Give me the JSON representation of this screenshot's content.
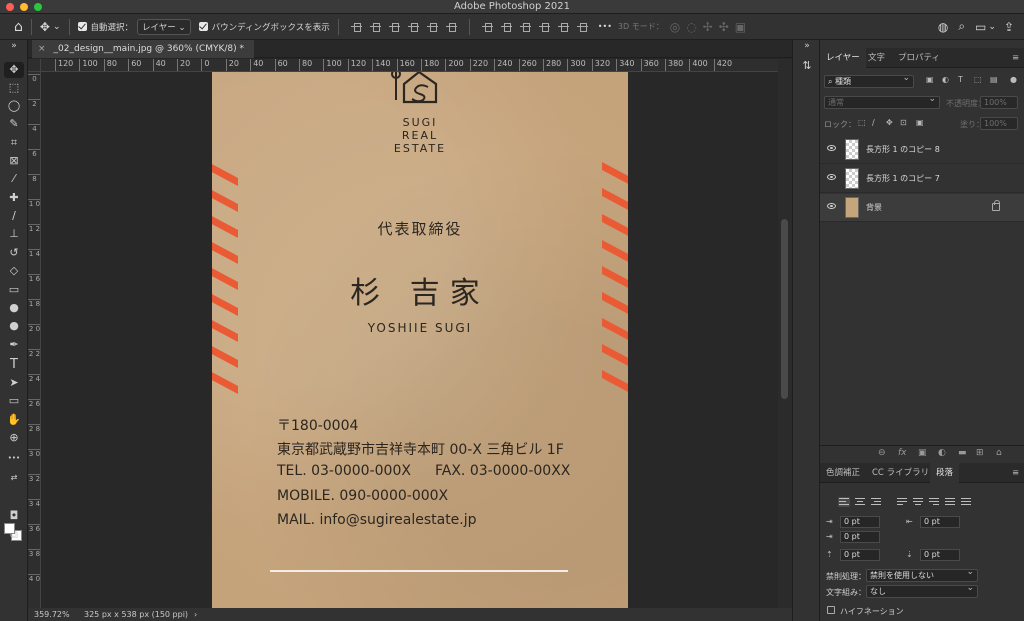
{
  "window": {
    "title": "Adobe Photoshop 2021"
  },
  "options_bar": {
    "auto_select_label": "自動選択：",
    "auto_select_target": "レイヤー",
    "bounding_box_label": "バウンディングボックスを表示",
    "mode_3d_label": "3D モード："
  },
  "document": {
    "tab_title": "_02_design__main.jpg @ 360% (CMYK/8) *",
    "close_glyph": "×",
    "zoom": "359.72%",
    "size_info": "325 px x 538 px (150 ppi)",
    "status_arrow": "›"
  },
  "ruler": {
    "h_ticks": [
      "120",
      "100",
      "80",
      "60",
      "40",
      "20",
      "0",
      "20",
      "40",
      "60",
      "80",
      "100",
      "120",
      "140",
      "160",
      "180",
      "200",
      "220",
      "240",
      "260",
      "280",
      "300",
      "320",
      "340",
      "360",
      "380",
      "400",
      "420"
    ],
    "v_ticks": [
      "0",
      "2",
      "4",
      "6",
      "8",
      "1 0",
      "1 2",
      "1 4",
      "1 6",
      "1 8",
      "2 0",
      "2 2",
      "2 4",
      "2 6",
      "2 8",
      "3 0",
      "3 2",
      "3 4",
      "3 6",
      "3 8",
      "4 0"
    ]
  },
  "card": {
    "logo_lines": [
      "SUGI",
      "REAL",
      "ESTATE"
    ],
    "title": "代表取締役",
    "name_jp": "杉 吉家",
    "name_en": "YOSHIIE SUGI",
    "postal": "〒180-0004",
    "address": "東京都武蔵野市吉祥寺本町 00-X 三角ビル 1F",
    "tel": "TEL. 03-0000-000X",
    "fax": "FAX. 03-0000-00XX",
    "mobile": "MOBILE. 090-0000-000X",
    "mail": "MAIL. info@sugirealestate.jp",
    "colors": {
      "kraft": "#c8a77f",
      "stripe": "#ea5b35",
      "ink": "#2b2620"
    }
  },
  "layers_panel": {
    "tabs": [
      "レイヤー",
      "文字",
      "プロパティ"
    ],
    "filter_label": "種類",
    "blend_mode": "通常",
    "opacity_label": "不透明度：",
    "opacity_value": "100%",
    "lock_label": "ロック：",
    "fill_label": "塗り：",
    "fill_value": "100%",
    "layers": [
      {
        "name": "長方形 1 のコピー 8",
        "visible": true,
        "locked": false
      },
      {
        "name": "長方形 1 のコピー 7",
        "visible": true,
        "locked": false
      },
      {
        "name": "背景",
        "visible": true,
        "locked": true
      }
    ],
    "footer_icons": [
      "link-icon",
      "fx-icon",
      "mask-icon",
      "adjustment-icon",
      "folder-icon",
      "new-layer-icon",
      "trash-icon"
    ]
  },
  "paragraph_panel": {
    "tabs": [
      "色調補正",
      "CC ライブラリ",
      "段落"
    ],
    "indent_left": "0 pt",
    "indent_right": "0 pt",
    "indent_first": "0 pt",
    "space_before": "0 pt",
    "space_after": "0 pt",
    "kinsoku_label": "禁則処理：",
    "kinsoku_value": "禁則を使用しない",
    "mojikumi_label": "文字組み：",
    "mojikumi_value": "なし",
    "hyphenation_label": "ハイフネーション"
  },
  "glyphs": {
    "home": "⌂",
    "move": "✥",
    "chevron": "⌄",
    "dots": "•••",
    "search": "⌕",
    "panels_more": "»",
    "panel_menu": "≡",
    "fx": "fx",
    "text_tool": "T",
    "hand": "✋",
    "zoom": "⊕"
  }
}
